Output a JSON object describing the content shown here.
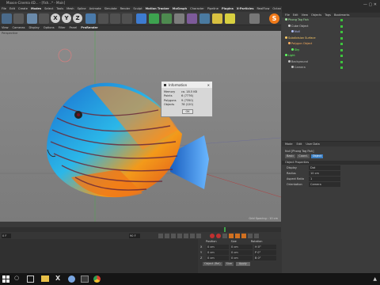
{
  "window": {
    "title": "Maxon-Cinema 4D... - [fish...* - Main]"
  },
  "menubar": [
    "File",
    "Edit",
    "Create",
    "Modes",
    "Select",
    "Tools",
    "Mesh",
    "Spline",
    "Animate",
    "Simulate",
    "Render",
    "Sculpt",
    "Motion Tracker",
    "MoGraph",
    "Character",
    "Pipeline",
    "Plugins",
    "X-Particles",
    "RealFlow",
    "Octane",
    "Script",
    "Window",
    "Help"
  ],
  "toolbar": {
    "xyz": [
      "X",
      "Y",
      "Z"
    ]
  },
  "viewport_menu": [
    "View",
    "Cameras",
    "Display",
    "Options",
    "Filter",
    "Panel",
    "ProRender"
  ],
  "viewport": {
    "perspective_label": "Perspective",
    "grid_label": "Grid Spacing : 10 cm"
  },
  "dialog": {
    "title": "Information",
    "rows": [
      {
        "label": "Memory",
        "value": "ca. 18.5 KB"
      },
      {
        "label": "Points",
        "value": "6 (7776)"
      },
      {
        "label": "Polygons",
        "value": "9 (7350)"
      },
      {
        "label": "Objects",
        "value": "78 (120)"
      }
    ],
    "ok": "OK"
  },
  "object_manager": {
    "menu": [
      "File",
      "Edit",
      "View",
      "Objects",
      "Tags",
      "Bookmarks"
    ],
    "items": [
      {
        "name": "Phong Tag Fish",
        "color": "#a0e0a0"
      },
      {
        "name": "Cube Object",
        "color": "#d0d0d0"
      },
      {
        "name": "Null",
        "color": "#b0c0ff"
      },
      {
        "name": "Subdivision Surface",
        "color": "#ffcc66"
      },
      {
        "name": "Polygon Object",
        "color": "#ffb060"
      },
      {
        "name": "Sky",
        "color": "#60ff60"
      },
      {
        "name": "Light",
        "color": "#60ff60"
      },
      {
        "name": "Background",
        "color": "#c0c0c0"
      },
      {
        "name": "Camera",
        "color": "#c0c0c0"
      }
    ]
  },
  "attributes": {
    "menu": [
      "Mode",
      "Edit",
      "User Data"
    ],
    "header": "Null [Phong Tag Fish]",
    "tabs": [
      "Basic",
      "Coord.",
      "Object"
    ],
    "section": "Object Properties",
    "fields": [
      {
        "label": "Display",
        "value": "Dot"
      },
      {
        "label": "Radius",
        "value": "10 cm"
      },
      {
        "label": "Aspect Ratio",
        "value": "1"
      },
      {
        "label": "Orientation",
        "value": "Camera"
      }
    ]
  },
  "timeline": {
    "ticks": [
      "0",
      "5",
      "10",
      "15",
      "20",
      "25",
      "30",
      "35",
      "40",
      "45",
      "50",
      "55",
      "60",
      "65",
      "70",
      "75",
      "80",
      "85",
      "90"
    ],
    "current_frame": "0 F",
    "end_frame": "90 F"
  },
  "coordinates": {
    "headers": [
      "Position",
      "Size",
      "Rotation"
    ],
    "rows": [
      {
        "axis": "X",
        "pos": "0 cm",
        "size": "0 cm",
        "rot": "H 0°"
      },
      {
        "axis": "Y",
        "pos": "0 cm",
        "size": "0 cm",
        "rot": "P 0°"
      },
      {
        "axis": "Z",
        "pos": "0 cm",
        "size": "0 cm",
        "rot": "B 0°"
      }
    ],
    "mode": "Object (Rel)",
    "size_mode": "Size",
    "apply": "Apply"
  },
  "taskbar": {
    "search_placeholder": "Type here to search"
  }
}
